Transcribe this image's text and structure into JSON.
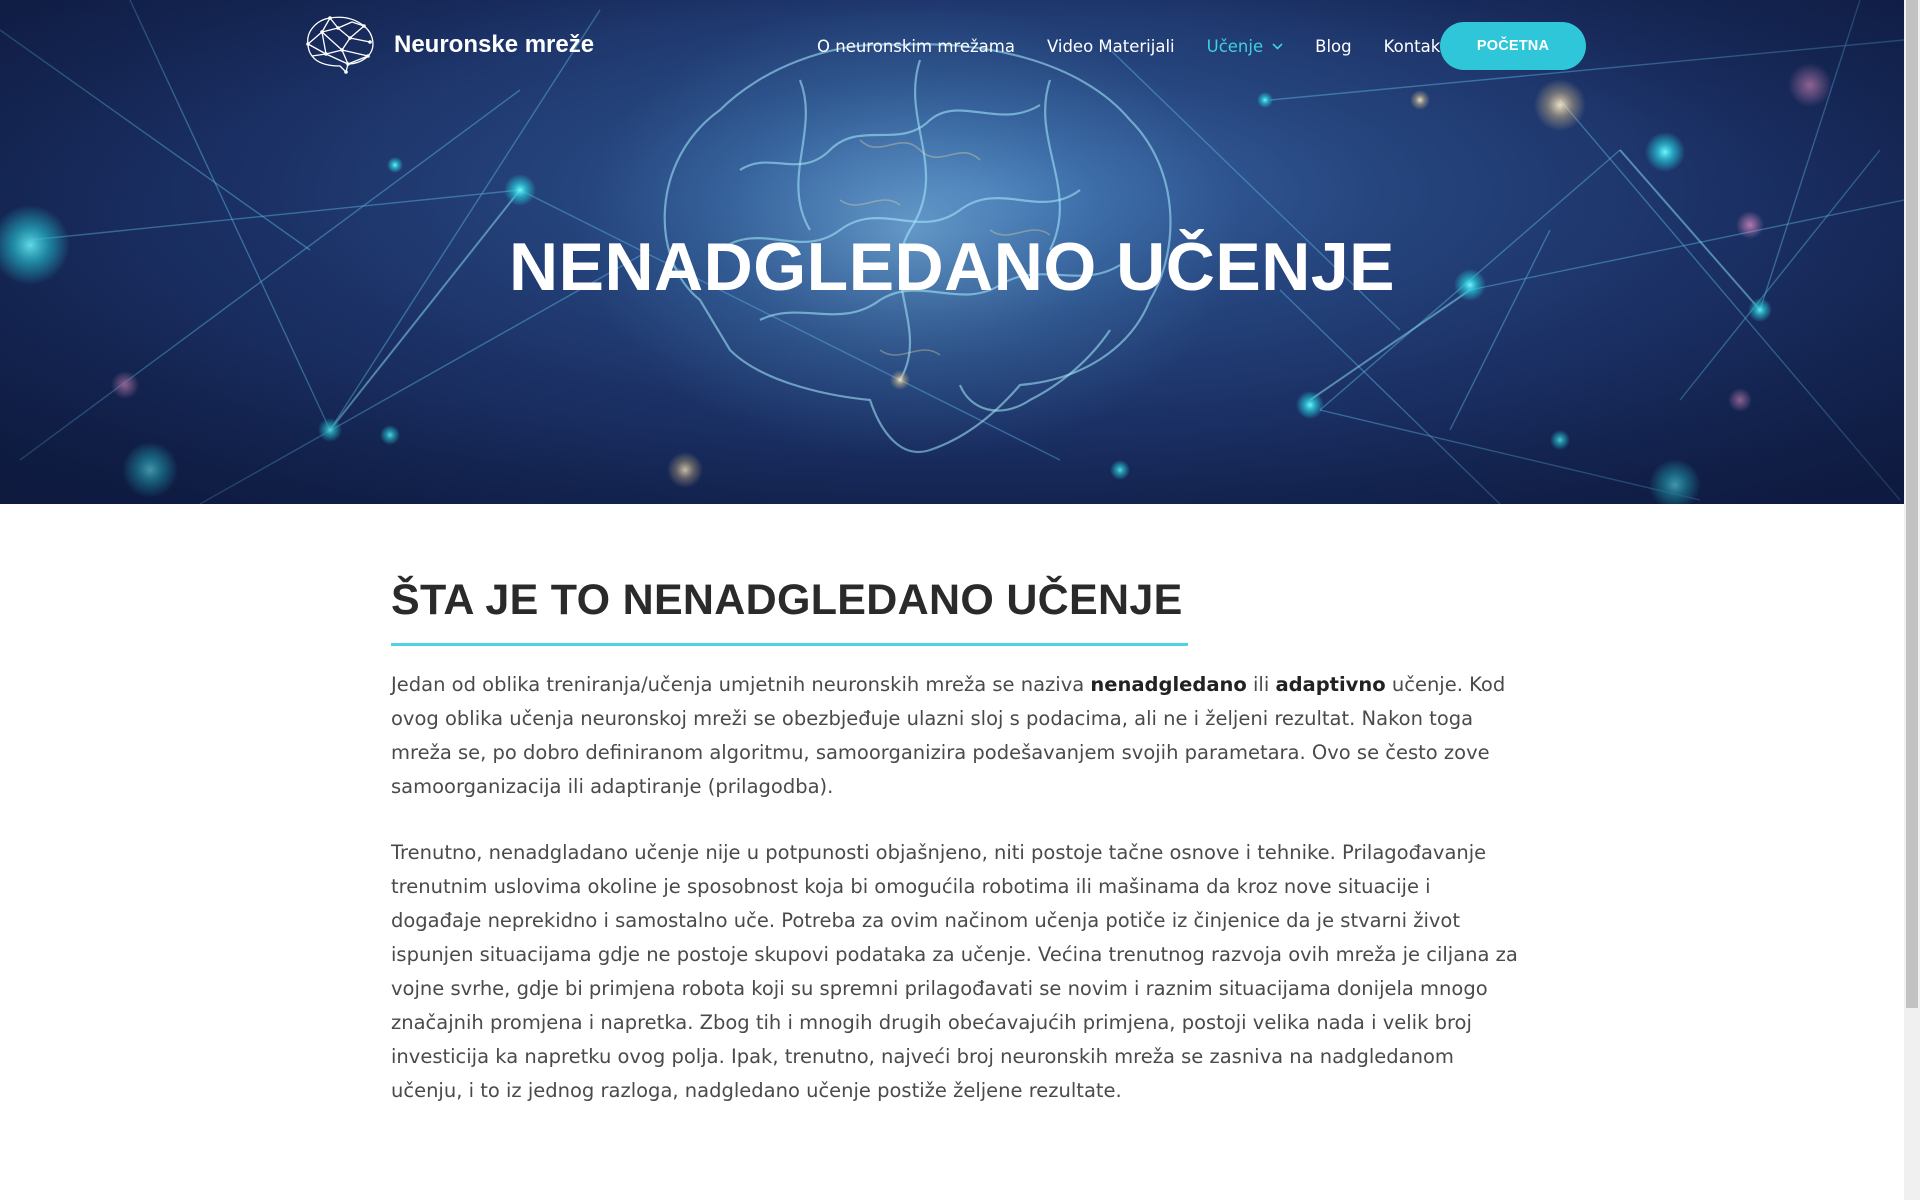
{
  "header": {
    "brand_name": "Neuronske mreže",
    "logo_icon": "brain-polygon-icon",
    "nav": [
      {
        "label": "O neuronskim mrežama",
        "active": false
      },
      {
        "label": "Video Materijali",
        "active": false
      },
      {
        "label": "Učenje",
        "active": true,
        "has_dropdown": true,
        "dropdown_icon": "chevron-down-icon"
      },
      {
        "label": "Blog",
        "active": false
      },
      {
        "label": "Kontakt",
        "active": false
      }
    ],
    "cta_label": "POČETNA"
  },
  "hero": {
    "title": "NENADGLEDANO UČENJE",
    "background": "brain-network-image"
  },
  "main": {
    "section_title": "ŠTA JE TO NENADGLEDANO UČENJE",
    "paragraph1": {
      "pre": "Jedan od oblika treniranja/učenja umjetnih neuronskih mreža se naziva ",
      "bold1": "nenadgledano",
      "mid": " ili ",
      "bold2": "adaptivno",
      "post": " učenje. Kod ovog oblika učenja neuronskoj mreži se obezbjeđuje ulazni sloj s podacima, ali ne i željeni rezultat. Nakon toga mreža se, po dobro definiranom algoritmu, samoorganizira podešavanjem svojih parametara. Ovo se često zove samoorganizacija ili adaptiranje (prilagodba)."
    },
    "paragraph2": "Trenutno, nenadgladano učenje nije u potpunosti objašnjeno, niti postoje tačne osnove i tehnike. Prilagođavanje trenutnim uslovima okoline  je sposobnost koja bi omogućila robotima ili mašinama da kroz nove situacije i događaje neprekidno i samostalno uče. Potreba za ovim načinom učenja potiče iz činjenice da je stvarni život ispunjen situacijama gdje ne postoje skupovi podataka za učenje. Većina trenutnog razvoja ovih mreža je ciljana za vojne svrhe, gdje bi primjena robota koji su spremni prilagođavati se novim i raznim situacijama donijela mnogo značajnih promjena i napretka. Zbog tih i mnogih drugih obećavajućih primjena, postoji velika nada i velik broj investicija ka napretku ovog polja. Ipak, trenutno, najveći broj neuronskih mreža se zasniva na nadgledanom učenju, i to iz jednog razloga, nadgledano učenje postiže željene rezultate."
  },
  "colors": {
    "accent": "#2fc6da",
    "accent_rule": "#4fd3e4",
    "nav_active": "#3fd0e0",
    "hero_bg": "#1a2f63",
    "heading": "#2a2a2a",
    "body_text": "#4a4a4a"
  }
}
